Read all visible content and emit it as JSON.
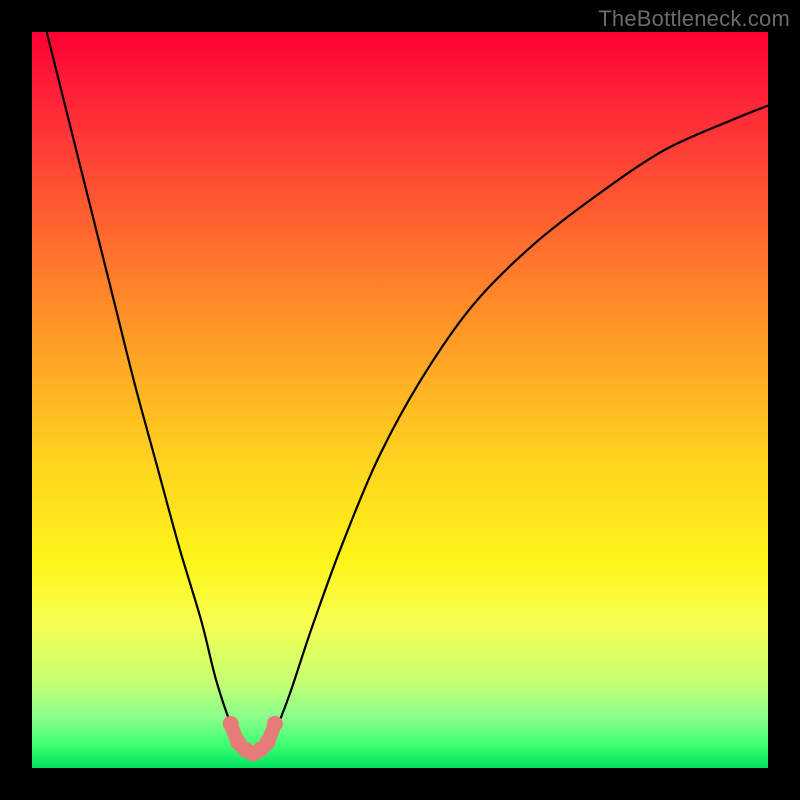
{
  "watermark": "TheBottleneck.com",
  "chart_data": {
    "type": "line",
    "title": "",
    "xlabel": "",
    "ylabel": "",
    "xlim": [
      0,
      100
    ],
    "ylim": [
      0,
      100
    ],
    "series": [
      {
        "name": "bottleneck-curve",
        "x": [
          2,
          5,
          8,
          11,
          14,
          17,
          20,
          23,
          25,
          27,
          28.5,
          30,
          31.5,
          33,
          35,
          38,
          42,
          47,
          53,
          60,
          68,
          77,
          86,
          95,
          100
        ],
        "values": [
          100,
          88,
          76,
          64,
          52,
          41,
          30,
          20,
          12,
          6,
          3,
          2,
          3,
          5,
          10,
          19,
          30,
          42,
          53,
          63,
          71,
          78,
          84,
          88,
          90
        ]
      },
      {
        "name": "highlight-dots",
        "x": [
          27,
          28,
          29,
          30,
          31,
          32,
          33
        ],
        "values": [
          6,
          3.5,
          2.5,
          2,
          2.5,
          3.5,
          6
        ]
      }
    ],
    "colors": {
      "curve": "#000000",
      "dots": "#e77b79"
    },
    "gradient_stops": [
      {
        "pos": 0,
        "color": "#ff0033"
      },
      {
        "pos": 50,
        "color": "#ffd21f"
      },
      {
        "pos": 85,
        "color": "#f8ff50"
      },
      {
        "pos": 100,
        "color": "#00e060"
      }
    ]
  }
}
